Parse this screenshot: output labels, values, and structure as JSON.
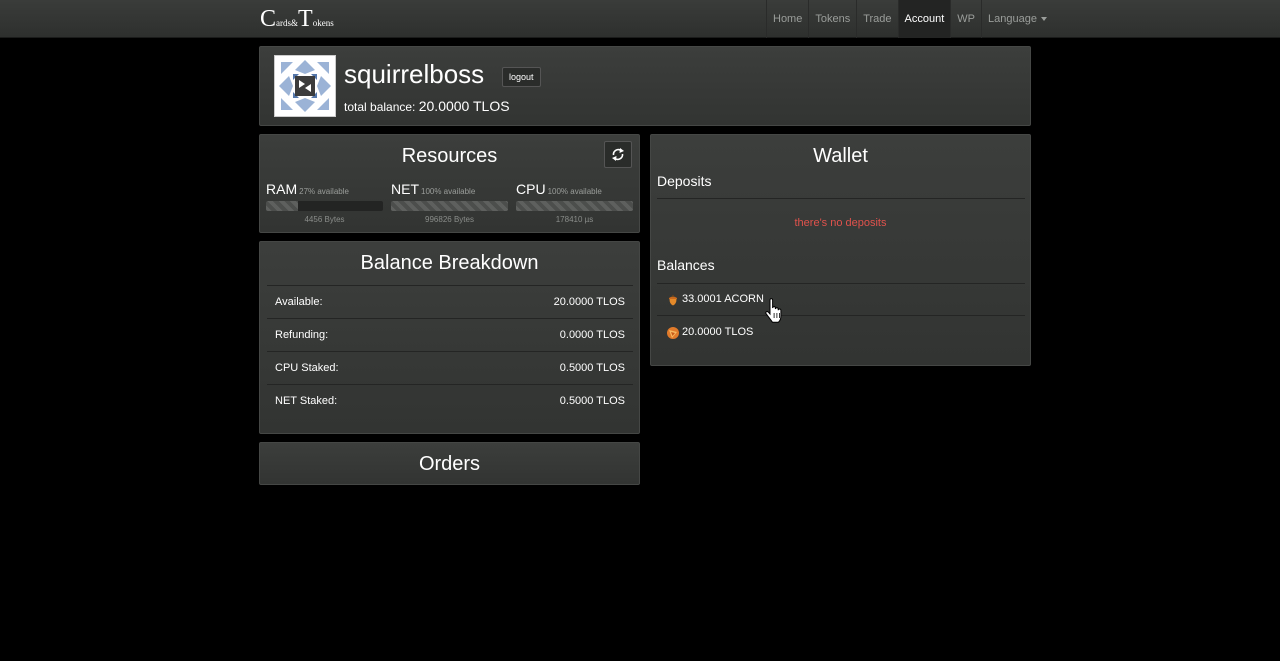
{
  "brand": {
    "big1": "C",
    "small1": "ards",
    "amp": "&",
    "big2": "T",
    "small2": "okens"
  },
  "nav": {
    "items": [
      {
        "label": "Home"
      },
      {
        "label": "Tokens"
      },
      {
        "label": "Trade"
      },
      {
        "label": "Account",
        "active": true
      },
      {
        "label": "WP"
      },
      {
        "label": "Language"
      }
    ]
  },
  "profile": {
    "username": "squirrelboss",
    "logout_label": "logout",
    "total_balance_label": "total balance:",
    "total_balance_value": "20.0000 TLOS"
  },
  "resources": {
    "title": "Resources",
    "refresh_icon": "refresh-icon",
    "items": [
      {
        "name": "RAM",
        "available": "27% available",
        "available_pct": 27,
        "sub": "4456 Bytes"
      },
      {
        "name": "NET",
        "available": "100% available",
        "available_pct": 100,
        "sub": "996826 Bytes"
      },
      {
        "name": "CPU",
        "available": "100% available",
        "available_pct": 100,
        "sub": "178410 µs"
      }
    ]
  },
  "breakdown": {
    "title": "Balance Breakdown",
    "rows": [
      {
        "label": "Available:",
        "value": "20.0000 TLOS"
      },
      {
        "label": "Refunding:",
        "value": "0.0000 TLOS"
      },
      {
        "label": "CPU Staked:",
        "value": "0.5000 TLOS"
      },
      {
        "label": "NET Staked:",
        "value": "0.5000 TLOS"
      }
    ]
  },
  "orders": {
    "title": "Orders"
  },
  "wallet": {
    "title": "Wallet",
    "deposits_label": "Deposits",
    "no_deposits": "there's no deposits",
    "balances_label": "Balances",
    "balances": [
      {
        "icon": "acorn-icon",
        "text": "33.0001 ACORN"
      },
      {
        "icon": "telos-icon",
        "text": "20.0000 TLOS"
      }
    ]
  },
  "colors": {
    "accent_error": "#e0524c",
    "panel": "#3a3c3a",
    "background": "#000000"
  }
}
